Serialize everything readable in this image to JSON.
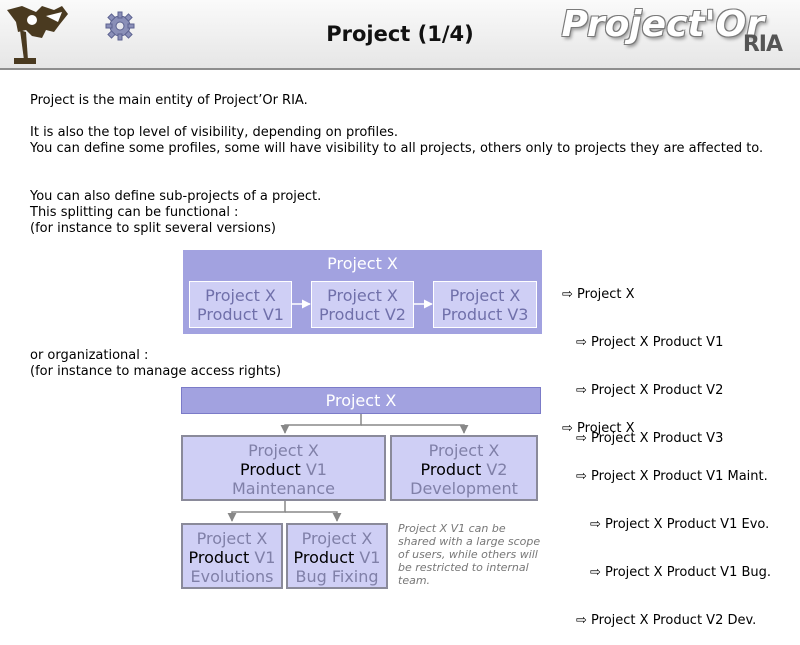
{
  "header": {
    "title": "Project (1/4)",
    "brand_main": "Project'Or",
    "brand_sub": "RIA"
  },
  "intro": {
    "p1": "Project is the main entity of Project’Or RIA.",
    "p2": "It is also the top level of visibility, depending on profiles.",
    "p3": "You can define some profiles, some will have visibility to all projects, others only to projects they are affected to.",
    "p4": "You can also define sub-projects of a project.",
    "p5": "This splitting can be functional :",
    "p6": "(for instance to split several versions)",
    "p7": "or organizational :",
    "p8": "(for instance to manage access rights)"
  },
  "functional": {
    "outer": "Project X",
    "boxes": [
      {
        "l1": "Project X",
        "l2": "Product V1"
      },
      {
        "l1": "Project X",
        "l2": "Product V2"
      },
      {
        "l1": "Project X",
        "l2": "Product V3"
      }
    ],
    "tree": [
      "Project X",
      "Project X Product V1",
      "Project X Product V2",
      "Project X Product V3"
    ]
  },
  "organizational": {
    "top": "Project X",
    "mid": [
      {
        "l1": "Project X",
        "l2a": "Product",
        "l2b": " V1",
        "l3": "Maintenance"
      },
      {
        "l1": "Project X",
        "l2a": "Product",
        "l2b": " V2",
        "l3": "Development"
      }
    ],
    "bottom": [
      {
        "l1": "Project X",
        "l2a": "Product",
        "l2b": " V1",
        "l3": "Evolutions"
      },
      {
        "l1": "Project X",
        "l2a": "Product",
        "l2b": " V1",
        "l3": "Bug Fixing"
      }
    ],
    "tree": [
      "Project X",
      "Project X Product V1 Maint.",
      "Project X Product V1 Evo.",
      "Project X Product V1 Bug.",
      "Project X Product V2 Dev."
    ],
    "note": "Project X V1 can be shared with a large scope of users, while others will be restricted to internal team."
  },
  "icons": {
    "logo": "logo-figure-icon",
    "settings": "gear-icon",
    "bullet": "arrow-bullet-icon"
  },
  "colors": {
    "box_dark": "#a2a2e0",
    "box_light": "#cfcff5"
  }
}
